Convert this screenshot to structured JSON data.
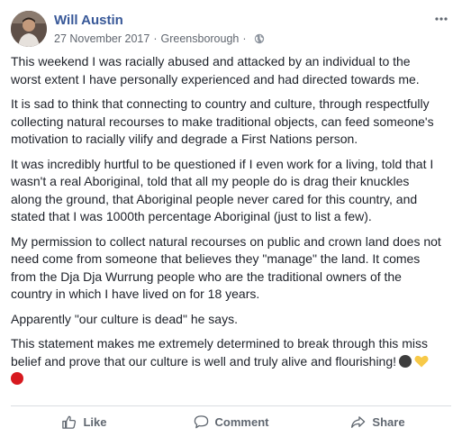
{
  "post": {
    "author": "Will Austin",
    "date": "27 November 2017",
    "separator": "·",
    "location": "Greensborough",
    "location_separator": "·",
    "paragraphs": [
      "This weekend I was racially abused and attacked by an individual to the worst extent I have personally experienced and had directed towards me.",
      "It is sad to think that connecting to country and culture, through respectfully collecting natural recourses to make traditional objects, can feed someone's motivation to racially vilify and degrade a First Nations person.",
      "It was incredibly hurtful to be questioned if I even work for a living, told that I wasn't a real Aboriginal, told that all my people do is drag their knuckles along the ground, that Aboriginal people never cared for this country, and stated that I was 1000th percentage Aboriginal (just to list a few).",
      "My permission to collect natural recourses on public and crown land does not need come from someone that believes they \"manage\" the land. It comes from the Dja Dja Wurrung people who are the traditional owners of the country in which I have lived on for 18 years.",
      "Apparently \"our culture is dead\" he says."
    ],
    "last_paragraph": "This statement makes me extremely determined to break through this miss belief and prove that our culture is well and truly alive and flourishing!",
    "emojis": [
      "black-circle-icon",
      "yellow-heart-icon",
      "red-circle-icon"
    ]
  },
  "actions": {
    "like": "Like",
    "comment": "Comment",
    "share": "Share"
  },
  "colors": {
    "author": "#385898",
    "meta": "#616770",
    "text": "#1d2129",
    "action": "#606770",
    "divider": "#dadde1",
    "heart": "#f7c948",
    "red": "#d7191f"
  }
}
